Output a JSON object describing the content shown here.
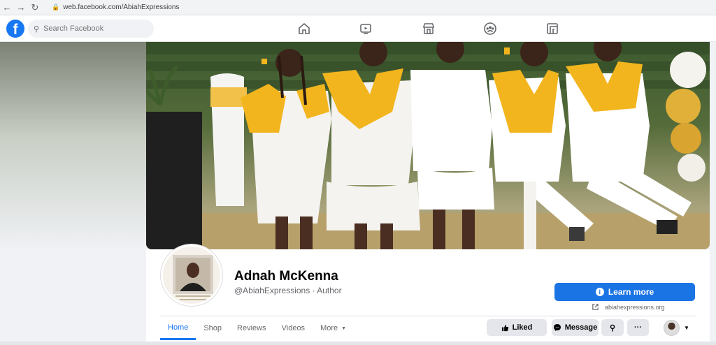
{
  "browser": {
    "back_icon": "←",
    "forward_icon": "→",
    "reload_icon": "↻",
    "lock_icon": "🔒",
    "url": "web.facebook.com/AbiahExpressions"
  },
  "header": {
    "logo": "f",
    "search_placeholder": "Search Facebook",
    "nav_icons": [
      "home-icon",
      "watch-icon",
      "marketplace-icon",
      "groups-icon",
      "gaming-icon"
    ]
  },
  "profile": {
    "name": "Adnah McKenna",
    "handle": "@AbiahExpressions · Author",
    "learn_more_label": "Learn more",
    "website": "abiahexpressions.org"
  },
  "tabs": [
    {
      "label": "Home",
      "active": true
    },
    {
      "label": "Shop"
    },
    {
      "label": "Reviews"
    },
    {
      "label": "Videos"
    },
    {
      "label": "More"
    }
  ],
  "actions": {
    "liked_label": "Liked",
    "message_label": "Message",
    "search_icon": "⚲",
    "more_icon": "···"
  },
  "colors": {
    "brand": "#1877f2",
    "button_blue": "#1b74e4",
    "gown_yellow": "#f2b51e"
  }
}
